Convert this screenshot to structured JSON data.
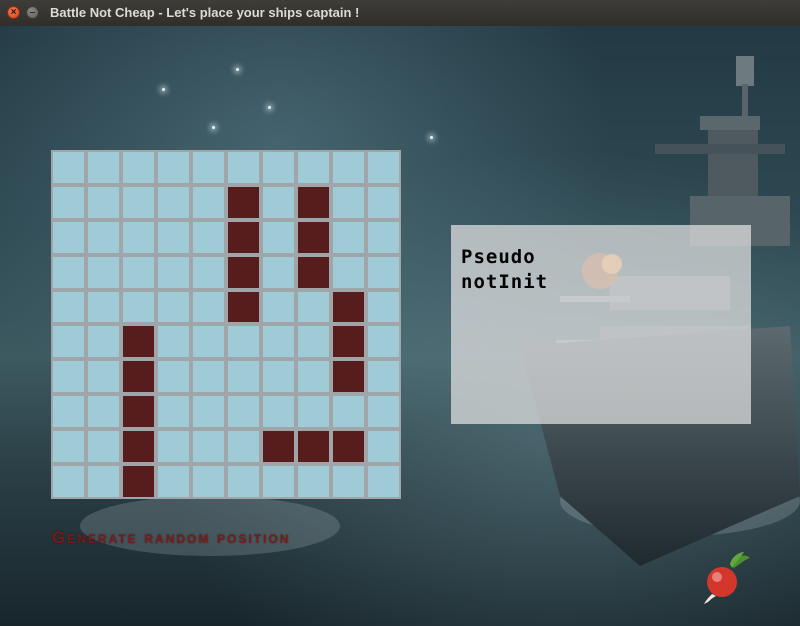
{
  "window": {
    "title": "Battle Not Cheap - Let's place your ships captain !",
    "close_glyph": "×",
    "minimize_glyph": "–"
  },
  "board": {
    "rows": 10,
    "cols": 10,
    "ship_cells": [
      [
        1,
        5
      ],
      [
        2,
        5
      ],
      [
        3,
        5
      ],
      [
        4,
        5
      ],
      [
        1,
        7
      ],
      [
        2,
        7
      ],
      [
        3,
        7
      ],
      [
        4,
        8
      ],
      [
        5,
        8
      ],
      [
        6,
        8
      ],
      [
        5,
        2
      ],
      [
        6,
        2
      ],
      [
        7,
        2
      ],
      [
        8,
        2
      ],
      [
        9,
        2
      ],
      [
        8,
        6
      ],
      [
        8,
        7
      ],
      [
        8,
        8
      ]
    ],
    "water_color": "#9fcbd7",
    "ship_color": "#561d1c"
  },
  "panel": {
    "line1": "Pseudo",
    "line2": "notInit"
  },
  "actions": {
    "generate_label": "Generate random position"
  },
  "icons": {
    "logo": "radish-icon"
  }
}
